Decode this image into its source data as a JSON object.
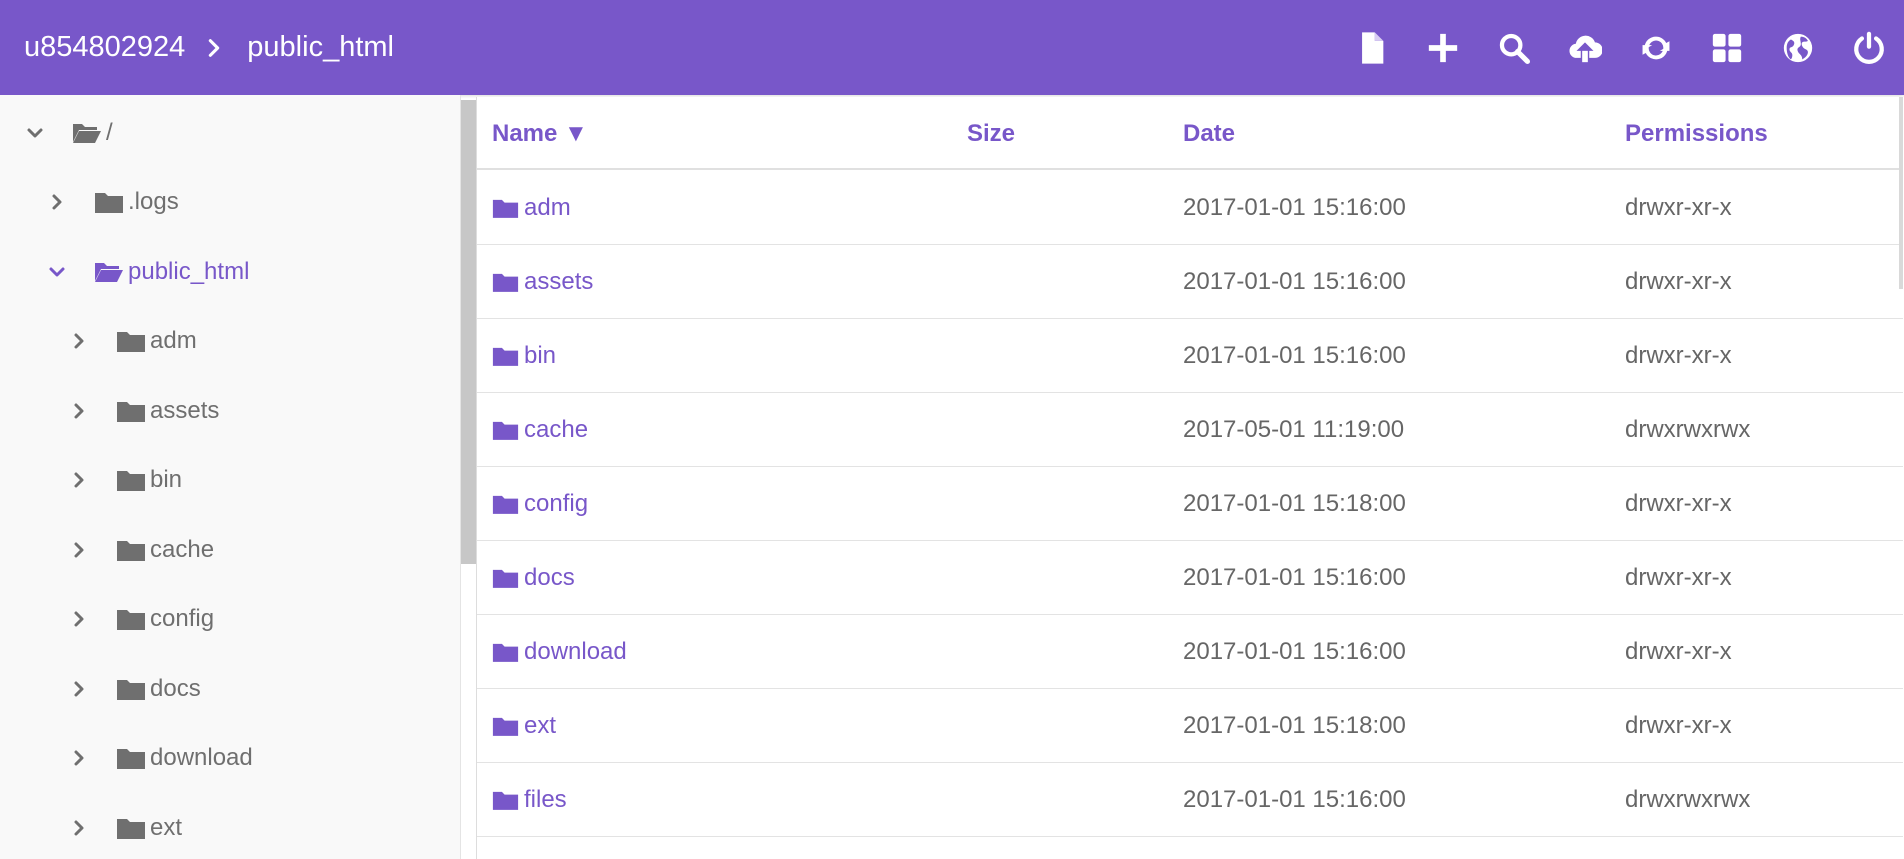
{
  "header": {
    "breadcrumb": [
      "u854802924",
      "public_html"
    ],
    "tools": [
      {
        "name": "new-file-icon"
      },
      {
        "name": "plus-icon"
      },
      {
        "name": "search-icon"
      },
      {
        "name": "cloud-upload-icon"
      },
      {
        "name": "refresh-icon"
      },
      {
        "name": "grid-icon"
      },
      {
        "name": "globe-icon"
      },
      {
        "name": "power-icon"
      }
    ],
    "accent": "#7857c9"
  },
  "tree": {
    "root": "/",
    "items": [
      {
        "label": ".logs",
        "level": 1,
        "expanded": false,
        "active": false
      },
      {
        "label": "public_html",
        "level": 1,
        "expanded": true,
        "active": true
      },
      {
        "label": "adm",
        "level": 2,
        "expanded": false,
        "active": false
      },
      {
        "label": "assets",
        "level": 2,
        "expanded": false,
        "active": false
      },
      {
        "label": "bin",
        "level": 2,
        "expanded": false,
        "active": false
      },
      {
        "label": "cache",
        "level": 2,
        "expanded": false,
        "active": false
      },
      {
        "label": "config",
        "level": 2,
        "expanded": false,
        "active": false
      },
      {
        "label": "docs",
        "level": 2,
        "expanded": false,
        "active": false
      },
      {
        "label": "download",
        "level": 2,
        "expanded": false,
        "active": false
      },
      {
        "label": "ext",
        "level": 2,
        "expanded": false,
        "active": false
      }
    ]
  },
  "table": {
    "columns": {
      "name": "Name ▼",
      "size": "Size",
      "date": "Date",
      "permissions": "Permissions"
    },
    "rows": [
      {
        "name": "adm",
        "size": "",
        "date": "2017-01-01 15:16:00",
        "permissions": "drwxr-xr-x"
      },
      {
        "name": "assets",
        "size": "",
        "date": "2017-01-01 15:16:00",
        "permissions": "drwxr-xr-x"
      },
      {
        "name": "bin",
        "size": "",
        "date": "2017-01-01 15:16:00",
        "permissions": "drwxr-xr-x"
      },
      {
        "name": "cache",
        "size": "",
        "date": "2017-05-01 11:19:00",
        "permissions": "drwxrwxrwx"
      },
      {
        "name": "config",
        "size": "",
        "date": "2017-01-01 15:18:00",
        "permissions": "drwxr-xr-x"
      },
      {
        "name": "docs",
        "size": "",
        "date": "2017-01-01 15:16:00",
        "permissions": "drwxr-xr-x"
      },
      {
        "name": "download",
        "size": "",
        "date": "2017-01-01 15:16:00",
        "permissions": "drwxr-xr-x"
      },
      {
        "name": "ext",
        "size": "",
        "date": "2017-01-01 15:18:00",
        "permissions": "drwxr-xr-x"
      },
      {
        "name": "files",
        "size": "",
        "date": "2017-01-01 15:16:00",
        "permissions": "drwxrwxrwx"
      }
    ]
  }
}
